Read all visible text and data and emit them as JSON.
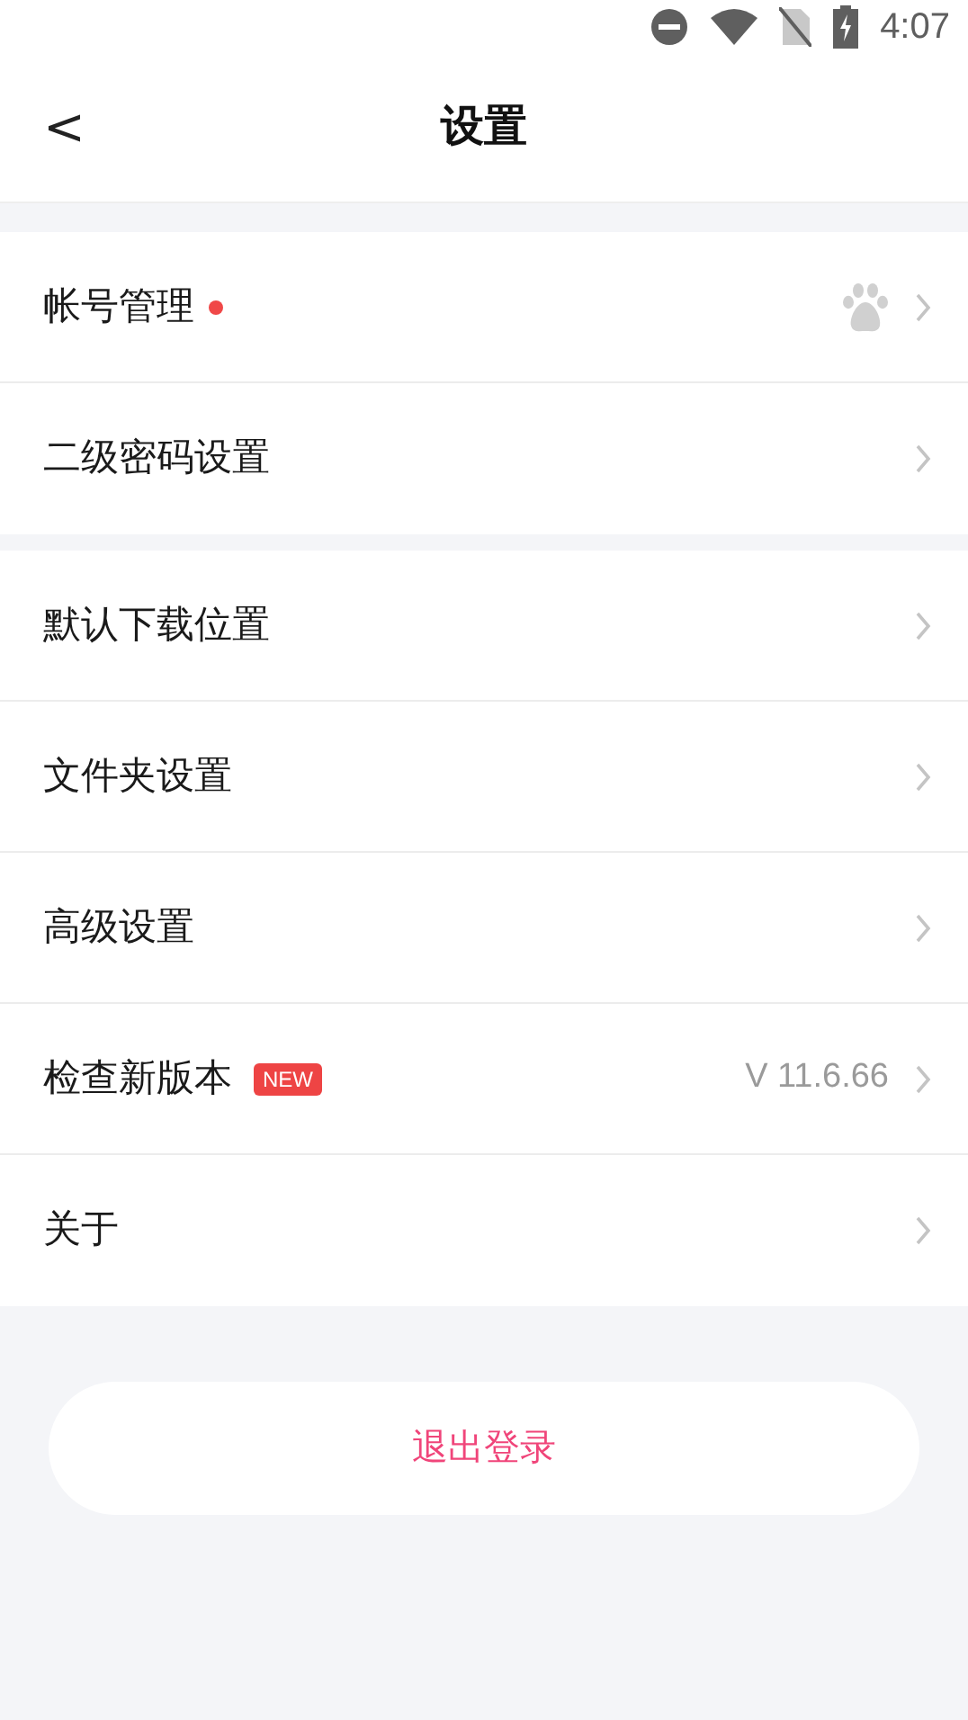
{
  "status_bar": {
    "time": "4:07"
  },
  "header": {
    "back": "<",
    "title": "设置"
  },
  "groups": [
    {
      "items": [
        {
          "label": "帐号管理",
          "dot": true,
          "linked_account": true
        },
        {
          "label": "二级密码设置"
        }
      ]
    },
    {
      "items": [
        {
          "label": "默认下载位置"
        },
        {
          "label": "文件夹设置"
        },
        {
          "label": "高级设置"
        },
        {
          "label": "检查新版本",
          "tag": "NEW",
          "value": "V 11.6.66"
        },
        {
          "label": "关于"
        }
      ]
    }
  ],
  "logout_button": "退出登录"
}
